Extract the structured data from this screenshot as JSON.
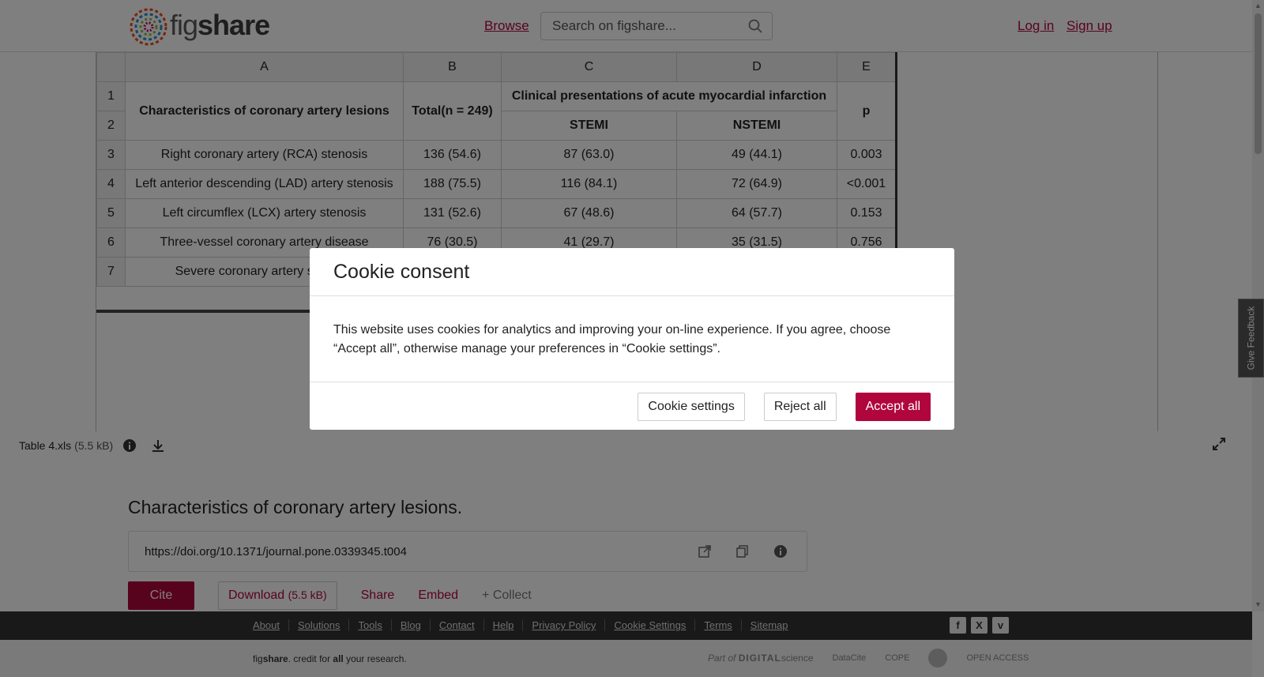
{
  "header": {
    "logo": {
      "prefix": "fig",
      "suffix": "share"
    },
    "browse_label": "Browse",
    "search_placeholder": "Search on figshare...",
    "login_label": "Log in",
    "signup_label": "Sign up"
  },
  "sheet": {
    "column_headers": [
      "A",
      "B",
      "C",
      "D",
      "E"
    ],
    "row_numbers": [
      "1",
      "2",
      "3",
      "4",
      "5",
      "6",
      "7"
    ],
    "header_cells": {
      "characteristics": "Characteristics of coronary artery lesions",
      "total": "Total(n = 249)",
      "clinical": "Clinical presentations of acute myocardial infarction",
      "p": "p",
      "stemi": "STEMI",
      "nstemi": "NSTEMI"
    },
    "rows": [
      [
        "Right coronary artery (RCA) stenosis",
        "136 (54.6)",
        "87 (63.0)",
        "49 (44.1)",
        "0.003"
      ],
      [
        "Left anterior descending (LAD) artery stenosis",
        "188 (75.5)",
        "116 (84.1)",
        "72 (64.9)",
        "<0.001"
      ],
      [
        "Left circumflex (LCX) artery stenosis",
        "131 (52.6)",
        "67 (48.6)",
        "64 (57.7)",
        "0.153"
      ],
      [
        "Three-vessel coronary artery disease",
        "76 (30.5)",
        "41 (29.7)",
        "35 (31.5)",
        "0.756"
      ],
      [
        "Severe coronary artery stenosis",
        "",
        "",
        "",
        ""
      ]
    ]
  },
  "file": {
    "name": "Table 4.xls",
    "size": "(5.5 kB)"
  },
  "article": {
    "title": "Characteristics of coronary artery lesions.",
    "doi": "https://doi.org/10.1371/journal.pone.0339345.t004",
    "cite_label": "Cite",
    "download_label": "Download",
    "download_size": "(5.5 kB)",
    "share_label": "Share",
    "embed_label": "Embed",
    "collect_label": "+ Collect"
  },
  "footer": {
    "links": [
      "About",
      "Solutions",
      "Tools",
      "Blog",
      "Contact",
      "Help",
      "Privacy Policy",
      "Cookie Settings",
      "Terms",
      "Sitemap"
    ],
    "social": [
      "f",
      "X",
      "v"
    ],
    "tagline": {
      "fig": "fig",
      "share": "share",
      "mid": ". credit for ",
      "all": "all",
      "end": " your research."
    },
    "partners": {
      "ds_prefix": "Part of",
      "ds_name": "DIGITAL",
      "ds_science": "science",
      "datacite": "DataCite",
      "cope": "COPE",
      "oa": "OPEN ACCESS"
    }
  },
  "feedback_label": "Give Feedback",
  "cookie_modal": {
    "title": "Cookie consent",
    "body": "This website uses cookies for analytics and improving your on-line experience. If you agree, choose “Accept all”, otherwise manage your preferences in “Cookie settings”.",
    "settings_label": "Cookie settings",
    "reject_label": "Reject all",
    "accept_label": "Accept all"
  },
  "colors": {
    "accent": "#b0063d",
    "footer_dark": "#333333"
  }
}
